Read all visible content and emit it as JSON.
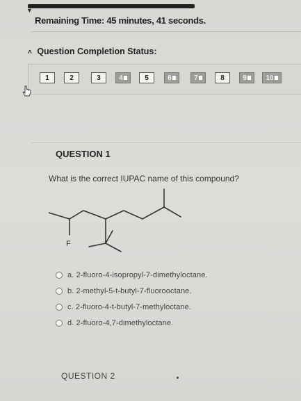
{
  "timer": {
    "label": "Remaining Time:",
    "value": "45 minutes, 41 seconds."
  },
  "status": {
    "title": "Question Completion Status:"
  },
  "question_numbers": [
    {
      "label": "1",
      "answered": false
    },
    {
      "label": "2",
      "answered": false
    },
    {
      "label": "3",
      "answered": false
    },
    {
      "label": "4",
      "answered": true
    },
    {
      "label": "5",
      "answered": false
    },
    {
      "label": "6",
      "answered": true
    },
    {
      "label": "7",
      "answered": true
    },
    {
      "label": "8",
      "answered": false
    },
    {
      "label": "9",
      "answered": true
    },
    {
      "label": "10",
      "answered": true
    }
  ],
  "question": {
    "title": "QUESTION 1",
    "prompt": "What is the correct IUPAC name of this compound?",
    "molecule_label": "F",
    "options": [
      {
        "letter": "a.",
        "text": "2-fluoro-4-isopropyl-7-dimethyloctane."
      },
      {
        "letter": "b.",
        "text": "2-methyl-5-t-butyl-7-fluorooctane."
      },
      {
        "letter": "c.",
        "text": "2-fluoro-4-t-butyl-7-methyloctane."
      },
      {
        "letter": "d.",
        "text": "2-fluoro-4,7-dimethyloctane."
      }
    ]
  },
  "next_question": {
    "title": "QUESTION 2"
  }
}
